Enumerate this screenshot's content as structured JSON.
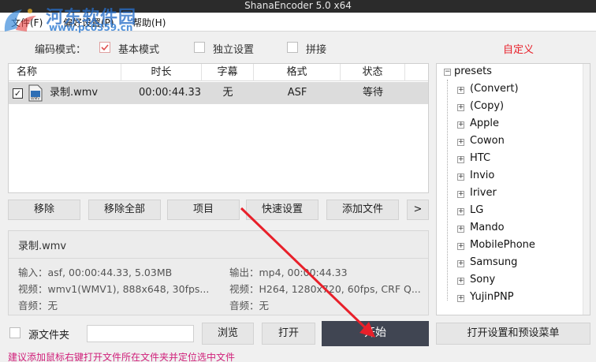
{
  "window": {
    "title": "ShanaEncoder 5.0 x64"
  },
  "watermark": {
    "text": "河东软件园",
    "url": "www.pc0359.cn"
  },
  "menu": {
    "file": "文件(F)",
    "prefs": "偏好设置(P)",
    "help": "帮助(H)"
  },
  "options": {
    "encode_mode_label": "编码模式：",
    "basic_mode": "基本模式",
    "independent": "独立设置",
    "concat": "拼接",
    "custom": "自定义"
  },
  "file_table": {
    "columns": [
      "名称",
      "时长",
      "字幕",
      "格式",
      "状态"
    ],
    "rows": [
      {
        "name": "录制.wmv",
        "duration": "00:00:44.33",
        "subtitle": "无",
        "format": "ASF",
        "status": "等待"
      }
    ]
  },
  "buttons": {
    "remove": "移除",
    "remove_all": "移除全部",
    "item": "项目",
    "quick": "快速设置",
    "add_file": "添加文件",
    "more": ">"
  },
  "info": {
    "filename": "录制.wmv",
    "input": "输入：asf, 00:00:44.33, 5.03MB",
    "video_in": "视频：wmv1(WMV1), 888x648, 30fps...",
    "audio_in": "音频：无",
    "output": "输出：mp4, 00:00:44.33",
    "video_out": "视频：H264, 1280x720, 60fps, CRF Q...",
    "audio_out": "音频：无"
  },
  "presets": {
    "root": "presets",
    "items": [
      "(Convert)",
      "(Copy)",
      "Apple",
      "Cowon",
      "HTC",
      "Invio",
      "Iriver",
      "LG",
      "Mando",
      "MobilePhone",
      "Samsung",
      "Sony",
      "YujinPNP"
    ]
  },
  "bottom": {
    "source_folder": "源文件夹",
    "browse": "浏览",
    "open": "打开",
    "start": "开始",
    "open_settings": "打开设置和预设菜单"
  },
  "status_tip": "建议添加鼠标右键打开文件所在文件夹并定位选中文件",
  "colors": {
    "accent_red": "#e8202a",
    "start_bg": "#404552",
    "status_pink": "#d0207a"
  }
}
